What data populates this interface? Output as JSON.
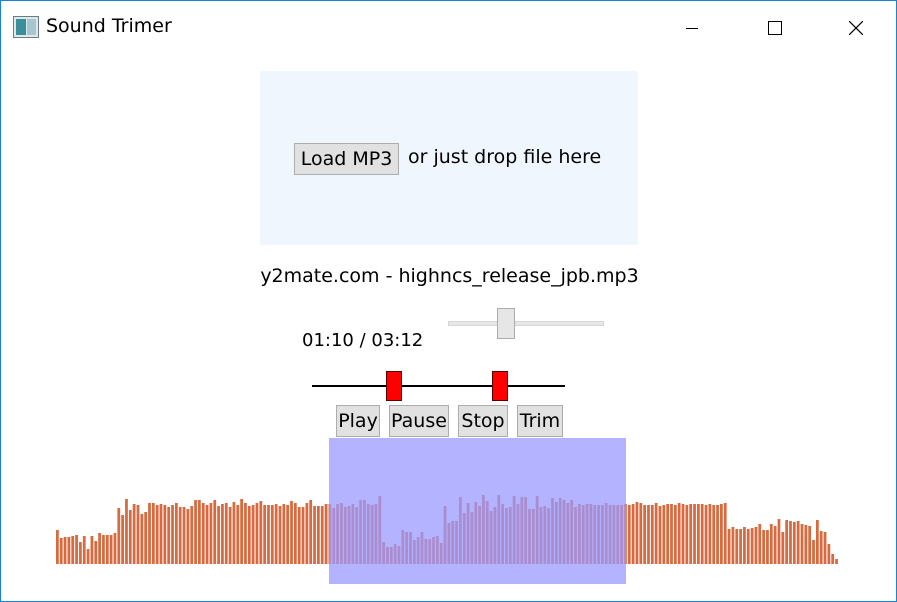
{
  "window": {
    "title": "Sound Trimer"
  },
  "drop_area": {
    "load_button": "Load MP3",
    "hint": "or just drop file here"
  },
  "file": {
    "name": "y2mate.com - highncs_release_jpb.mp3"
  },
  "playback": {
    "time": "01:10 / 03:12",
    "volume": 0.37
  },
  "trim_range": {
    "start_fraction": 0.32,
    "end_fraction": 0.74
  },
  "controls": {
    "play": "Play",
    "pause": "Pause",
    "stop": "Stop",
    "trim": "Trim"
  },
  "colors": {
    "waveform": "#d9693f",
    "selection": "#9999ff",
    "range_handle": "#ff0000",
    "drop_area": "#eff6fe"
  },
  "waveform": {
    "bars": [
      0.34,
      0.26,
      0.27,
      0.27,
      0.28,
      0.29,
      0.22,
      0.28,
      0.15,
      0.28,
      0.23,
      0.31,
      0.29,
      0.29,
      0.29,
      0.31,
      0.56,
      0.49,
      0.65,
      0.54,
      0.6,
      0.59,
      0.5,
      0.52,
      0.61,
      0.61,
      0.59,
      0.6,
      0.59,
      0.57,
      0.59,
      0.61,
      0.57,
      0.57,
      0.55,
      0.58,
      0.64,
      0.64,
      0.61,
      0.59,
      0.61,
      0.64,
      0.58,
      0.6,
      0.61,
      0.57,
      0.62,
      0.59,
      0.65,
      0.61,
      0.58,
      0.59,
      0.61,
      0.63,
      0.59,
      0.59,
      0.59,
      0.6,
      0.58,
      0.6,
      0.59,
      0.63,
      0.61,
      0.57,
      0.57,
      0.61,
      0.64,
      0.58,
      0.58,
      0.58,
      0.6,
      0.6,
      0.56,
      0.6,
      0.61,
      0.57,
      0.58,
      0.6,
      0.57,
      0.64,
      0.64,
      0.6,
      0.59,
      0.6,
      0.68,
      0.22,
      0.17,
      0.17,
      0.2,
      0.18,
      0.34,
      0.32,
      0.32,
      0.24,
      0.27,
      0.32,
      0.25,
      0.25,
      0.27,
      0.28,
      0.21,
      0.58,
      0.41,
      0.43,
      0.43,
      0.67,
      0.51,
      0.61,
      0.52,
      0.62,
      0.58,
      0.69,
      0.63,
      0.53,
      0.57,
      0.69,
      0.6,
      0.56,
      0.57,
      0.68,
      0.6,
      0.67,
      0.67,
      0.55,
      0.55,
      0.68,
      0.57,
      0.58,
      0.56,
      0.66,
      0.62,
      0.66,
      0.64,
      0.61,
      0.64,
      0.57,
      0.6,
      0.59,
      0.6,
      0.6,
      0.59,
      0.59,
      0.59,
      0.61,
      0.59,
      0.59,
      0.59,
      0.59,
      0.6,
      0.59,
      0.6,
      0.62,
      0.61,
      0.59,
      0.59,
      0.59,
      0.61,
      0.58,
      0.59,
      0.6,
      0.6,
      0.59,
      0.61,
      0.6,
      0.59,
      0.6,
      0.6,
      0.6,
      0.6,
      0.59,
      0.6,
      0.59,
      0.59,
      0.6,
      0.61,
      0.35,
      0.37,
      0.35,
      0.35,
      0.37,
      0.35,
      0.36,
      0.37,
      0.4,
      0.34,
      0.34,
      0.4,
      0.38,
      0.45,
      0.32,
      0.44,
      0.43,
      0.42,
      0.43,
      0.4,
      0.39,
      0.38,
      0.24,
      0.44,
      0.33,
      0.32,
      0.2,
      0.1,
      0.05
    ]
  }
}
